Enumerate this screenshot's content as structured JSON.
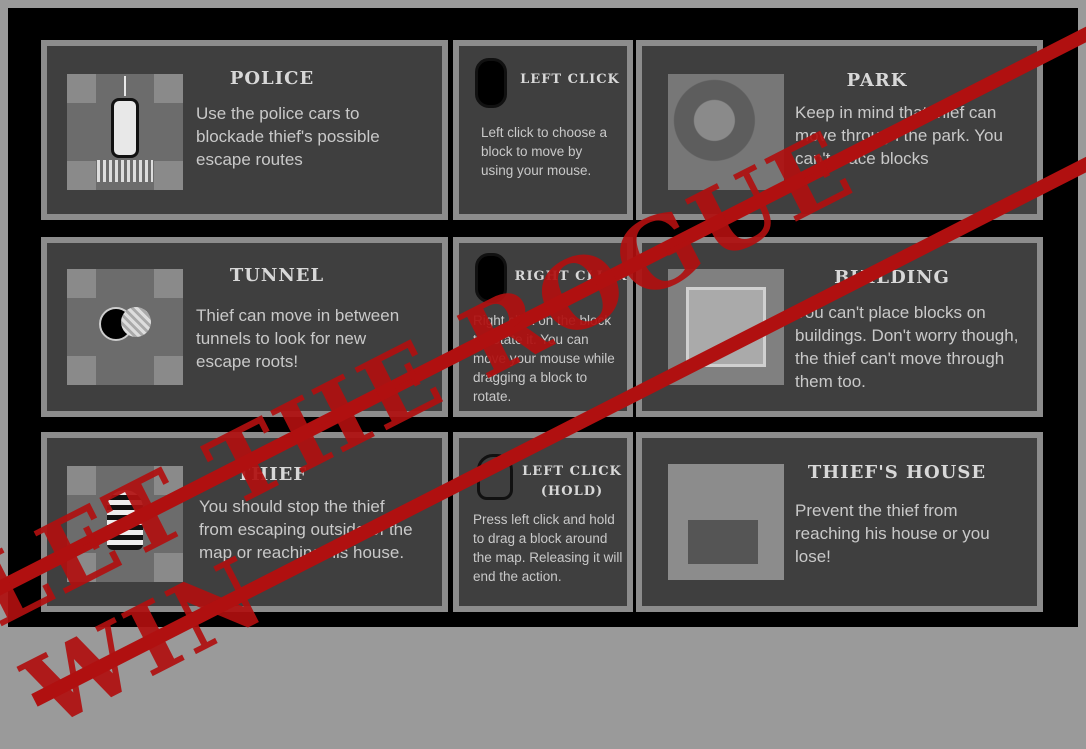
{
  "panels": {
    "police": {
      "title": "POLICE",
      "desc": "Use the police cars to blockade thief's possible escape routes"
    },
    "left_click": {
      "title": "LEFT CLICK",
      "desc": "Left click to choose a block to move by using your mouse."
    },
    "park": {
      "title": "PARK",
      "desc": "Keep in mind that thief can move through the park. You can't place blocks"
    },
    "tunnel": {
      "title": "TUNNEL",
      "desc": "Thief can move in between tunnels to look for new escape roots!"
    },
    "right_click": {
      "title": "RIGHT CLICK",
      "desc": "Right click on the block to rotate it. You can move your mouse while dragging a block to rotate."
    },
    "building": {
      "title": "BUILDING",
      "desc": "You can't place blocks on buildings. Don't worry though, the thief can't move through them too."
    },
    "thief": {
      "title": "THIEF",
      "desc": "You should stop the thief from escaping outside of the map or reaching his house."
    },
    "left_click_hold": {
      "title_line1": "LEFT CLICK",
      "title_line2": "(HOLD)",
      "desc": "Press left click and hold to drag a block around the map. Releasing it will end the action."
    },
    "thiefs_house": {
      "title": "THIEF'S HOUSE",
      "desc": "Prevent the thief from reaching his house or you lose!"
    }
  },
  "banner": {
    "text": "LET THE ROGUE WIN"
  },
  "colors": {
    "panel_bg": "#3f3f3f",
    "panel_border": "#8c8c8c",
    "banner": "#b01010"
  }
}
